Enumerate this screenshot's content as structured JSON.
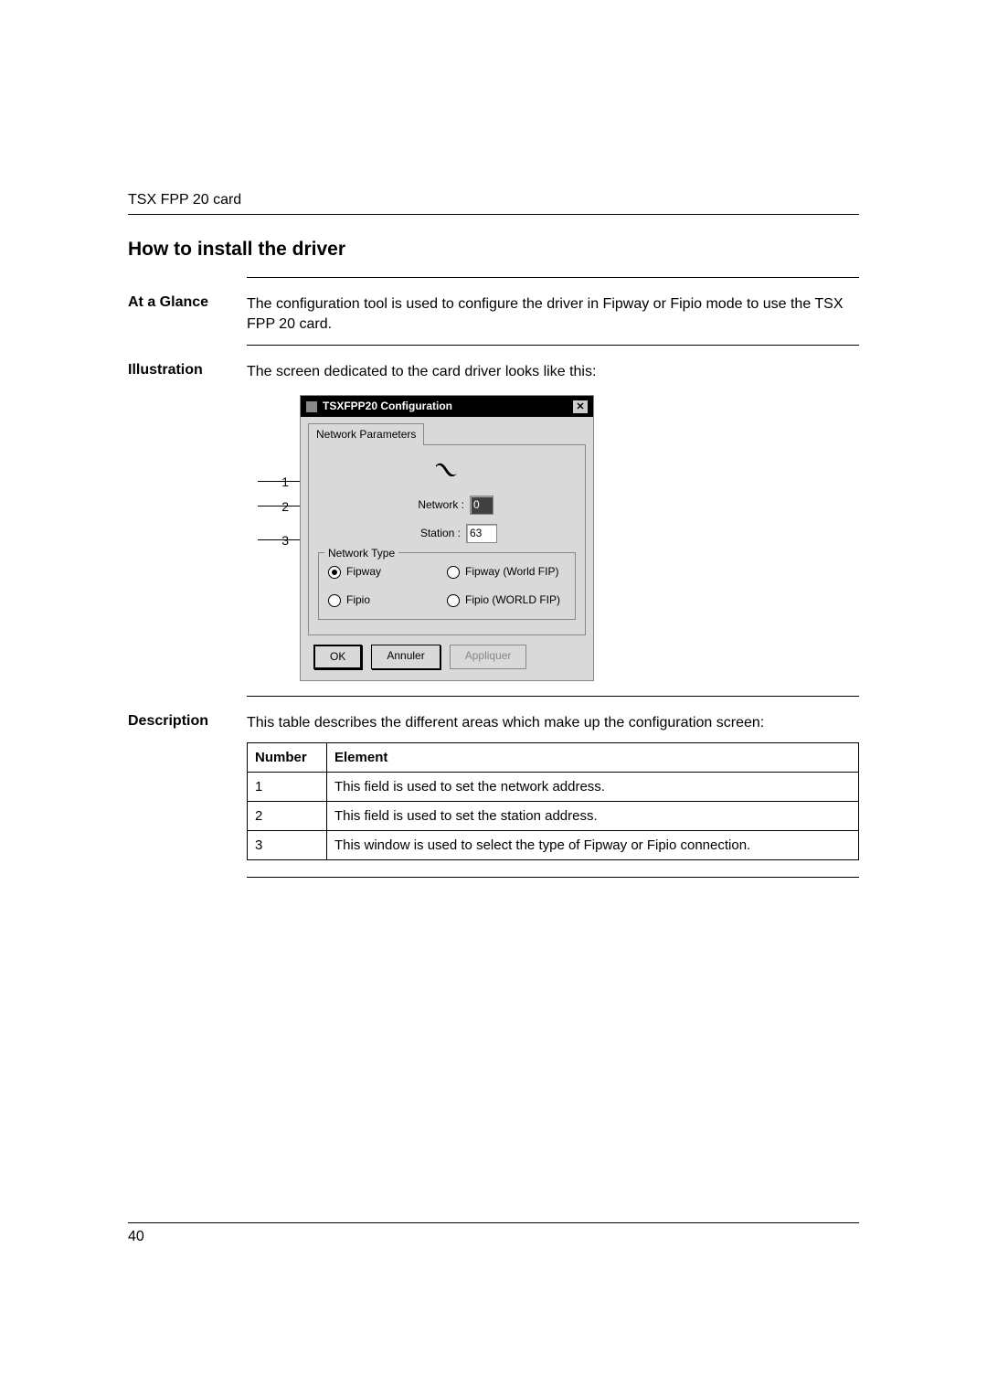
{
  "header": {
    "card_name": "TSX FPP 20 card"
  },
  "title": "How to install the driver",
  "at_a_glance": {
    "label": "At a Glance",
    "text": "The configuration tool is used to configure the driver in Fipway or Fipio mode to use the TSX FPP 20 card."
  },
  "illustration": {
    "label": "Illustration",
    "text": "The screen dedicated to the card driver looks like this:",
    "callouts": [
      "1",
      "2",
      "3"
    ],
    "dialog": {
      "title": "TSXFPP20 Configuration",
      "tab": "Network Parameters",
      "fields": {
        "network_label": "Network :",
        "network_value": "0",
        "station_label": "Station :",
        "station_value": "63"
      },
      "network_type": {
        "legend": "Network Type",
        "options": [
          {
            "label": "Fipway",
            "selected": true
          },
          {
            "label": "Fipway (World FIP)",
            "selected": false
          },
          {
            "label": "Fipio",
            "selected": false
          },
          {
            "label": "Fipio (WORLD FIP)",
            "selected": false
          }
        ]
      },
      "buttons": {
        "ok": "OK",
        "cancel": "Annuler",
        "apply": "Appliquer"
      }
    }
  },
  "description": {
    "label": "Description",
    "text": "This table describes the different areas which make up the configuration screen:",
    "columns": [
      "Number",
      "Element"
    ],
    "rows": [
      {
        "num": "1",
        "elem": "This field is used to set the network address."
      },
      {
        "num": "2",
        "elem": "This field is used to set the station address."
      },
      {
        "num": "3",
        "elem": "This window is used to select the type of Fipway or Fipio connection."
      }
    ]
  },
  "page_number": "40"
}
